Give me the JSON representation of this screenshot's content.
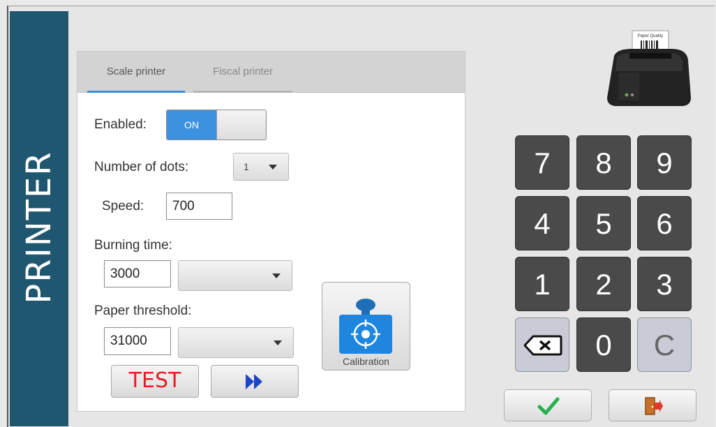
{
  "sidebar": {
    "title": "PRINTER"
  },
  "tabs": [
    {
      "label": "Scale printer",
      "active": true
    },
    {
      "label": "Fiscal printer",
      "active": false
    }
  ],
  "form": {
    "enabled_label": "Enabled:",
    "toggle_on_label": "ON",
    "dots_label": "Number of dots:",
    "dots_value": "1",
    "speed_label": "Speed:",
    "speed_value": "700",
    "burning_label": "Burning time:",
    "burning_value": "3000",
    "burning_select": "",
    "paper_label": "Paper threshold:",
    "paper_value": "31000",
    "paper_select": ""
  },
  "buttons": {
    "test_label": "TEST",
    "calibration_label": "Calibration"
  },
  "printer_image": {
    "label": "Paper Quality"
  },
  "keypad": {
    "keys": [
      "7",
      "8",
      "9",
      "4",
      "5",
      "6",
      "1",
      "2",
      "3",
      "0",
      "C"
    ]
  },
  "colors": {
    "sidebar": "#1f5670",
    "accent": "#3d92e0",
    "test_text": "#e41e26",
    "confirm": "#22b14c",
    "fast_forward": "#1d45c9"
  }
}
